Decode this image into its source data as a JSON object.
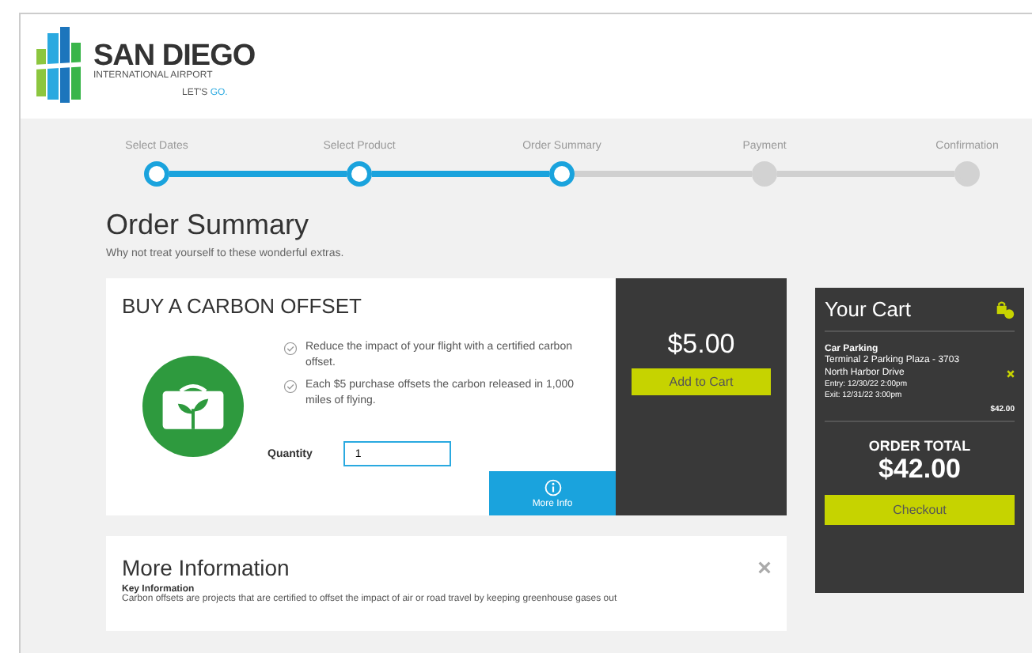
{
  "header": {
    "logo_title": "SAN DIEGO",
    "logo_subtitle": "INTERNATIONAL AIRPORT",
    "tagline_start": "LET'S",
    "tagline_end": "GO."
  },
  "steps": [
    {
      "label": "Select Dates",
      "completed": true
    },
    {
      "label": "Select Product",
      "completed": true
    },
    {
      "label": "Order Summary",
      "completed": true
    },
    {
      "label": "Payment",
      "completed": false
    },
    {
      "label": "Confirmation",
      "completed": false
    }
  ],
  "page": {
    "title": "Order Summary",
    "subtitle": "Why not treat yourself to these wonderful extras."
  },
  "offer": {
    "title": "BUY A CARBON OFFSET",
    "bullets": [
      "Reduce the impact of your flight with a certified carbon offset.",
      "Each $5 purchase offsets the carbon released in 1,000 miles of flying."
    ],
    "quantity_label": "Quantity",
    "quantity": "1",
    "price": "$5.00",
    "add_button": "Add to Cart",
    "more_info": "More Info"
  },
  "more_information": {
    "title": "More Information",
    "heading": "Key Information",
    "text": "Carbon offsets are projects that are certified to offset the impact of air or road travel by keeping greenhouse gases out"
  },
  "cart": {
    "title": "Your Cart",
    "items": [
      {
        "name": "Car Parking",
        "lines": [
          "Terminal 2 Parking Plaza - 3703",
          "North Harbor Drive"
        ],
        "entry": "Entry: 12/30/22 2:00pm",
        "exit": "Exit: 12/31/22 3:00pm",
        "price": "$42.00"
      }
    ],
    "total_label": "ORDER TOTAL",
    "total": "$42.00",
    "checkout": "Checkout"
  }
}
